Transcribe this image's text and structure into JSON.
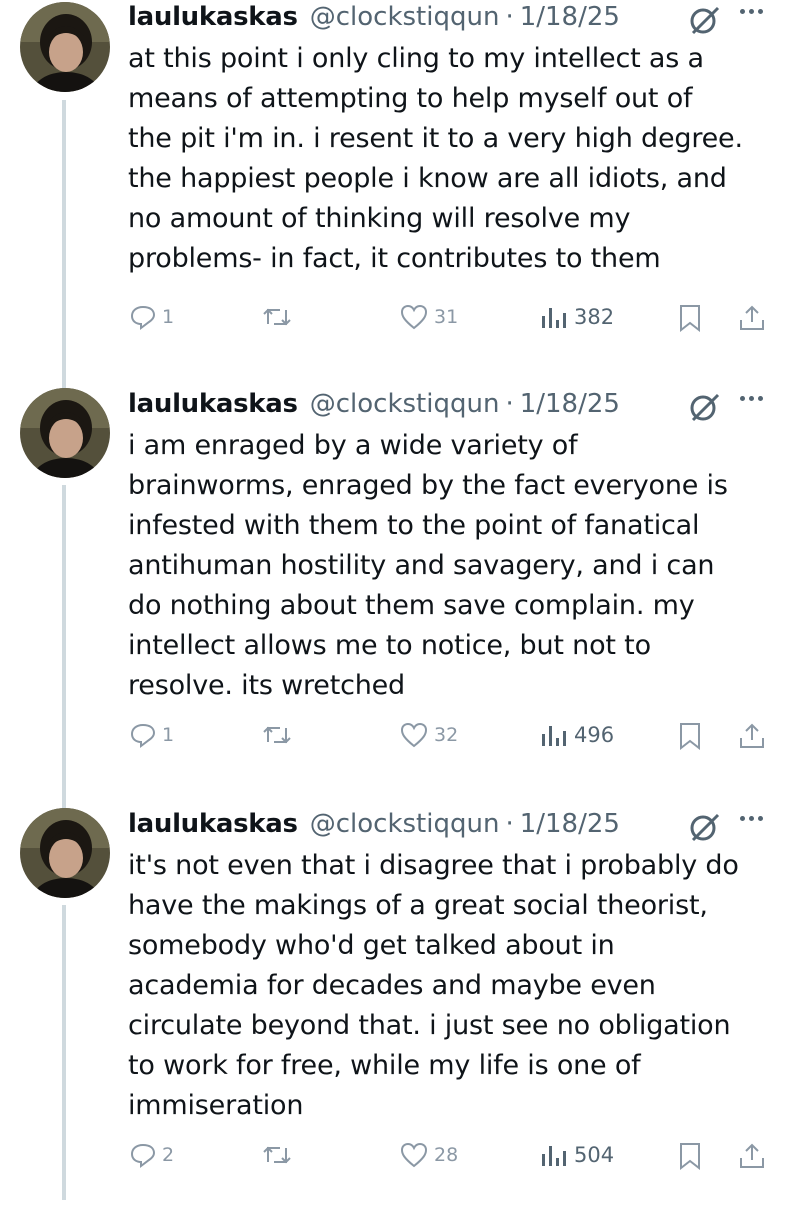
{
  "tweets": [
    {
      "name": "laulukaskas",
      "handle": "@clockstiqqun",
      "sep": "·",
      "date": "1/18/25",
      "text": "at this point i only cling to my intellect as a\nmeans of attempting to help myself out of\nthe pit i'm in. i resent it to a very high degree.\nthe happiest people i know are all idiots, and\nno amount of thinking will resolve my\nproblems- in fact, it contributes to them",
      "replies": "1",
      "likes": "31",
      "views": "382"
    },
    {
      "name": "laulukaskas",
      "handle": "@clockstiqqun",
      "sep": "·",
      "date": "1/18/25",
      "text": "i am enraged by a wide variety  of\nbrainworms, enraged by the fact everyone is\ninfested with them to the point of fanatical\nantihuman hostility and savagery, and i can\ndo nothing about them save complain. my\nintellect allows me to notice, but not to\nresolve. its wretched",
      "replies": "1",
      "likes": "32",
      "views": "496"
    },
    {
      "name": "laulukaskas",
      "handle": "@clockstiqqun",
      "sep": "·",
      "date": "1/18/25",
      "text": "it's not even that i disagree that i probably do\nhave the makings of a great social theorist,\nsomebody who'd get talked about in\nacademia for decades and maybe even\ncirculate beyond that. i just see no obligation\nto work for free, while my life is one of\nimmiseration",
      "replies": "2",
      "likes": "28",
      "views": "504"
    }
  ],
  "icons": {
    "reply": "reply-icon",
    "retweet": "retweet-icon",
    "like": "heart-icon",
    "views": "views-icon",
    "bookmark": "bookmark-icon",
    "share": "share-icon",
    "grok": "grok-icon",
    "more": "more-icon"
  },
  "colors": {
    "text": "#0f1419",
    "muted": "#536471",
    "icon": "#8b98a5",
    "thread_line": "#cfd9de"
  }
}
